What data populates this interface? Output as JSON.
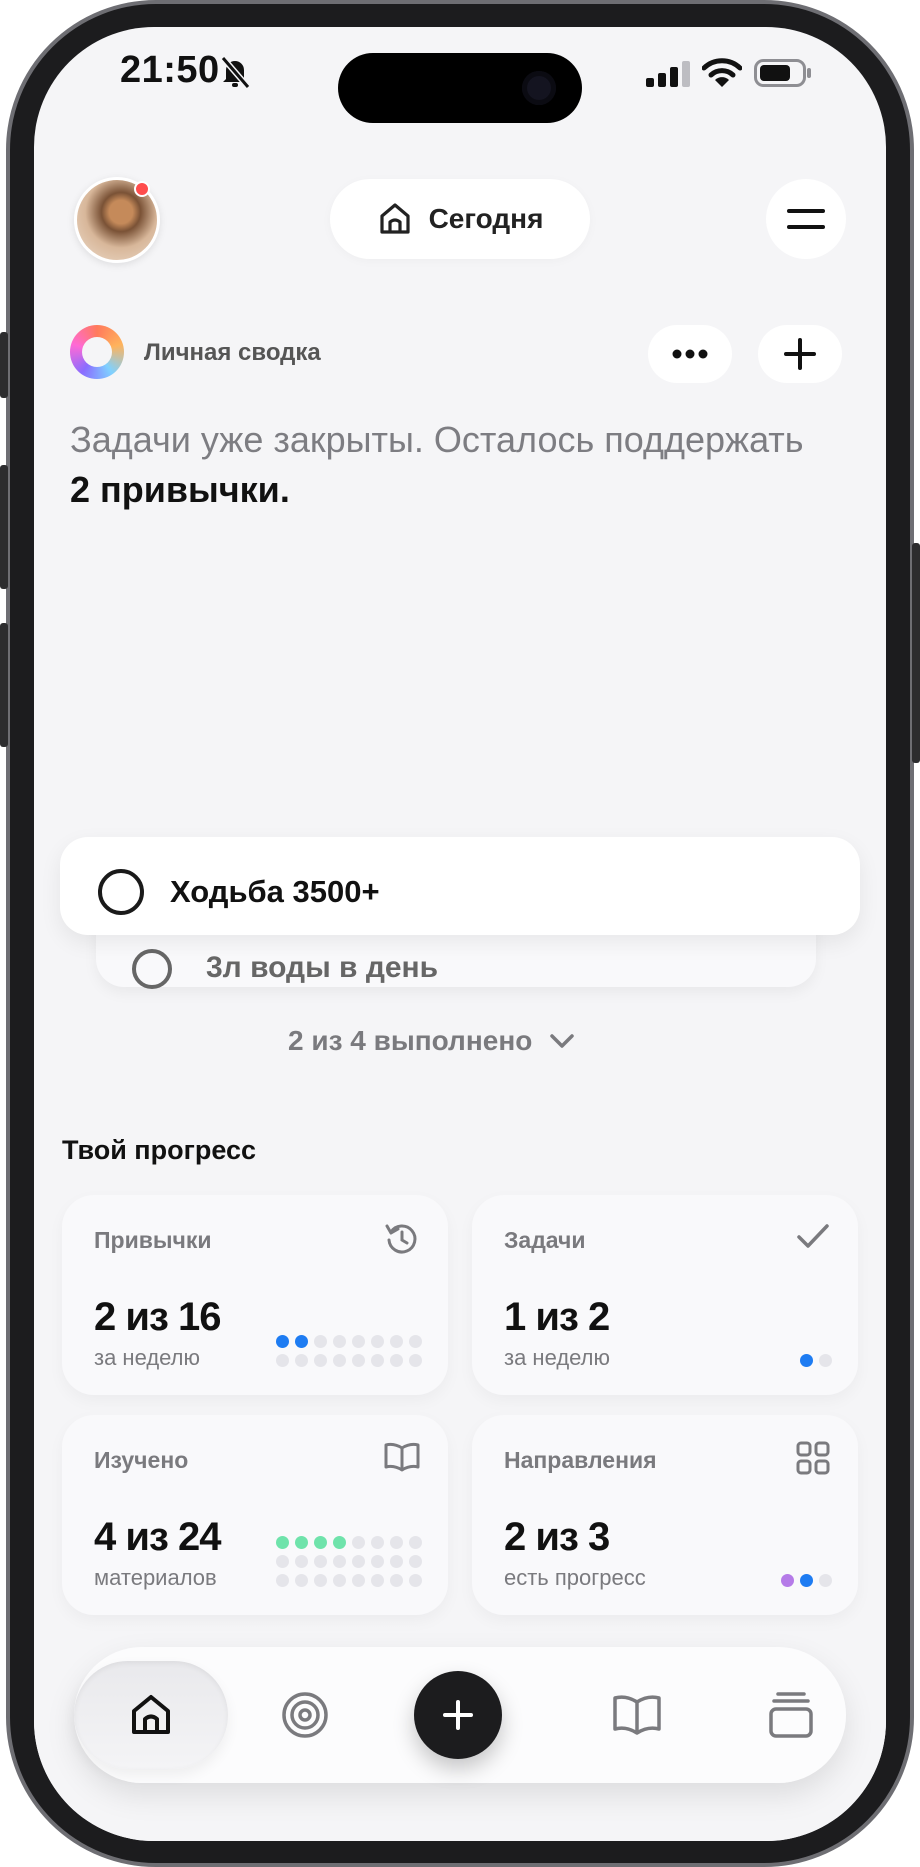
{
  "status_bar": {
    "time": "21:50",
    "icons": [
      "bell-slash-icon",
      "signal-icon",
      "wifi-icon",
      "battery-icon"
    ]
  },
  "header": {
    "today_label": "Сегодня",
    "has_notification": true,
    "accent": "#ff4d4d"
  },
  "summary": {
    "title": "Личная сводка",
    "text_lead": "Задачи уже закрыты. Осталось поддержать ",
    "text_bold": "2 привычки."
  },
  "tasks": {
    "front": "Ходьба 3500+",
    "back": "3л воды в день",
    "completed_label": "2 из 4 выполнено"
  },
  "progress": {
    "title": "Твой прогресс",
    "cards": [
      {
        "label": "Привычки",
        "value": "2 из 16",
        "sub": "за неделю",
        "icon": "history-icon"
      },
      {
        "label": "Задачи",
        "value": "1 из 2",
        "sub": "за неделю",
        "icon": "checkmark-icon"
      },
      {
        "label": "Изучено",
        "value": "4 из 24",
        "sub": "материалов",
        "icon": "book-icon"
      },
      {
        "label": "Направления",
        "value": "2 из 3",
        "sub": "есть прогресс",
        "icon": "grid-icon"
      }
    ],
    "colors": {
      "blue": "#1e7cf2",
      "green": "#6fe3ab",
      "purple": "#b57be8",
      "empty": "#e5e5ea"
    }
  },
  "tabbar": {
    "items": [
      "home-icon",
      "target-icon",
      "plus-icon",
      "book-icon",
      "archive-icon"
    ],
    "active": "home"
  }
}
